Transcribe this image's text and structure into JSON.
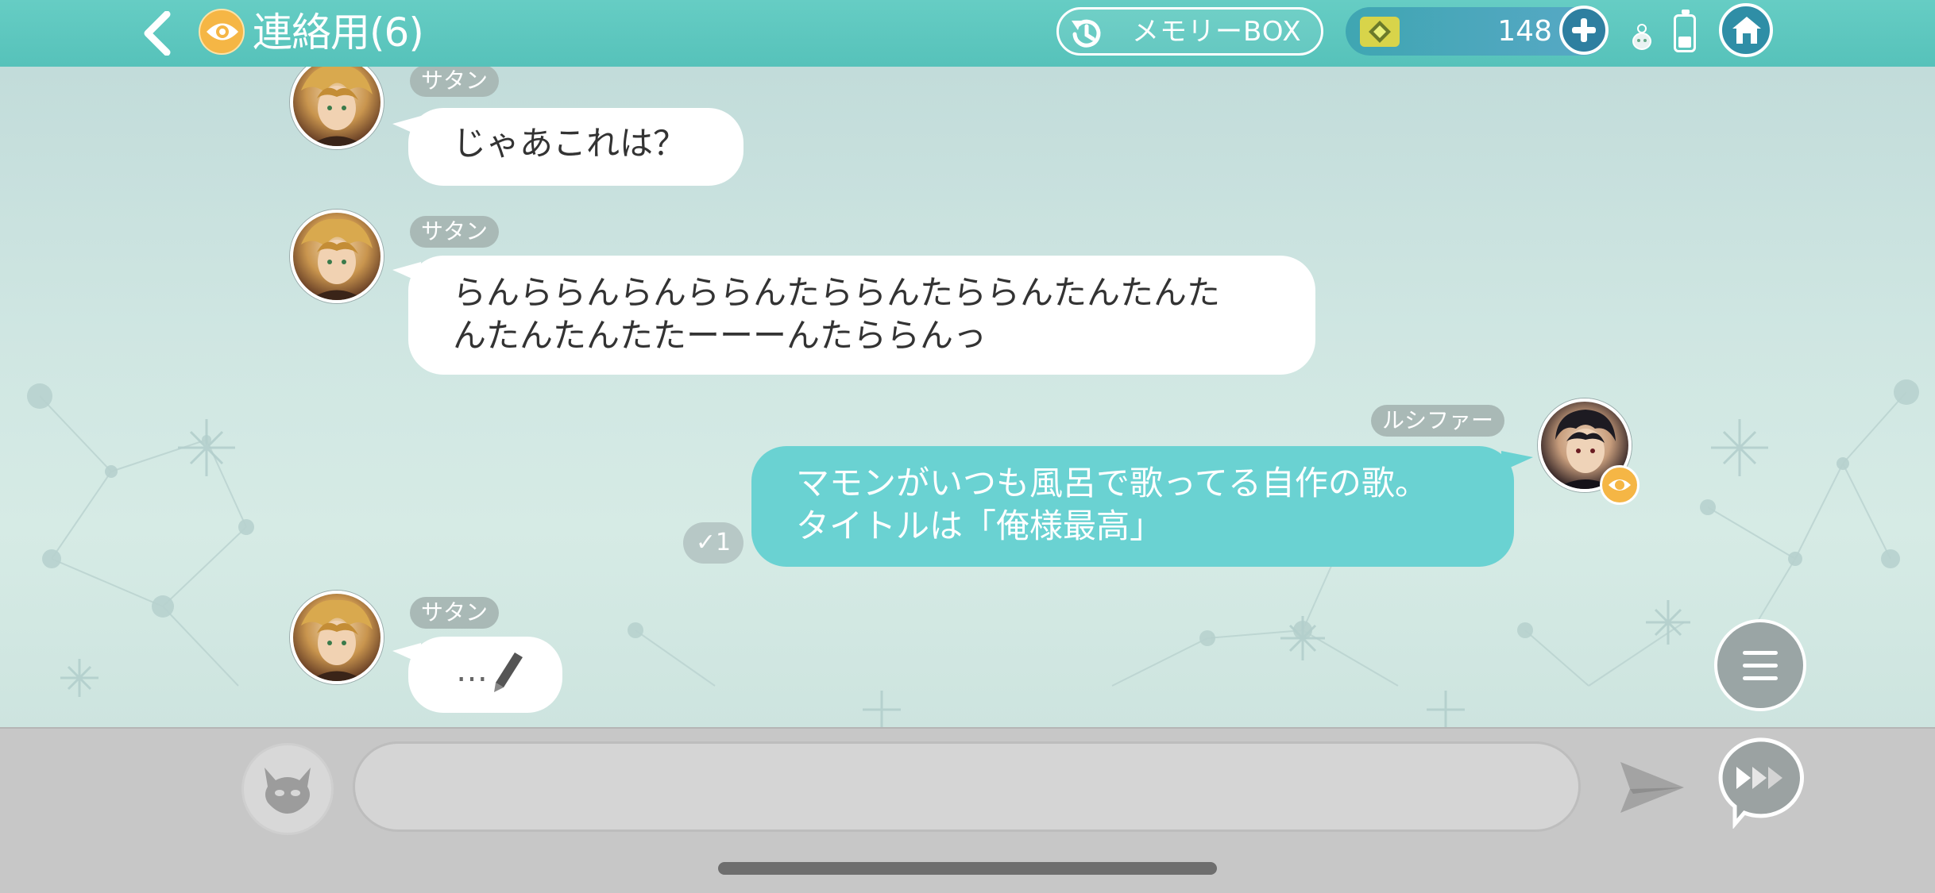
{
  "header": {
    "title": "連絡用(6)",
    "memory_button_label": "メモリーBOX",
    "gem_count": "148"
  },
  "messages": [
    {
      "sender": "サタン",
      "text_lines": [
        "じゃあこれは？"
      ]
    },
    {
      "sender": "サタン",
      "text_lines": [
        "らんららんらんららんたららんたららんたんたんた",
        "んたんたんたたーーーんたららんっ"
      ]
    },
    {
      "sender": "ルシファー",
      "text_lines": [
        "マモンがいつも風呂で歌ってる自作の歌。",
        "タイトルは「俺様最高」"
      ],
      "read_mark": "✓1"
    },
    {
      "sender": "サタン",
      "typing_text": "…"
    }
  ],
  "input": {
    "value": "",
    "placeholder": ""
  },
  "icons": {
    "back": "chevron-left-icon",
    "eye": "eye-icon",
    "memory": "history-icon",
    "gem": "gem-icon",
    "plus": "plus-icon",
    "home": "home-icon",
    "menu": "hamburger-icon",
    "stamp": "devil-face-icon",
    "send": "paper-plane-icon",
    "skip": "fast-forward-icon",
    "battery": "battery-icon",
    "pencil": "pencil-icon"
  },
  "colors": {
    "topbar": "#5cc7be",
    "my_bubble": "#6ad2d2",
    "their_bubble": "#ffffff",
    "name_tag": "#a9b9b6",
    "eye_badge": "#f5b645",
    "input_bar": "#c7c7c7"
  }
}
